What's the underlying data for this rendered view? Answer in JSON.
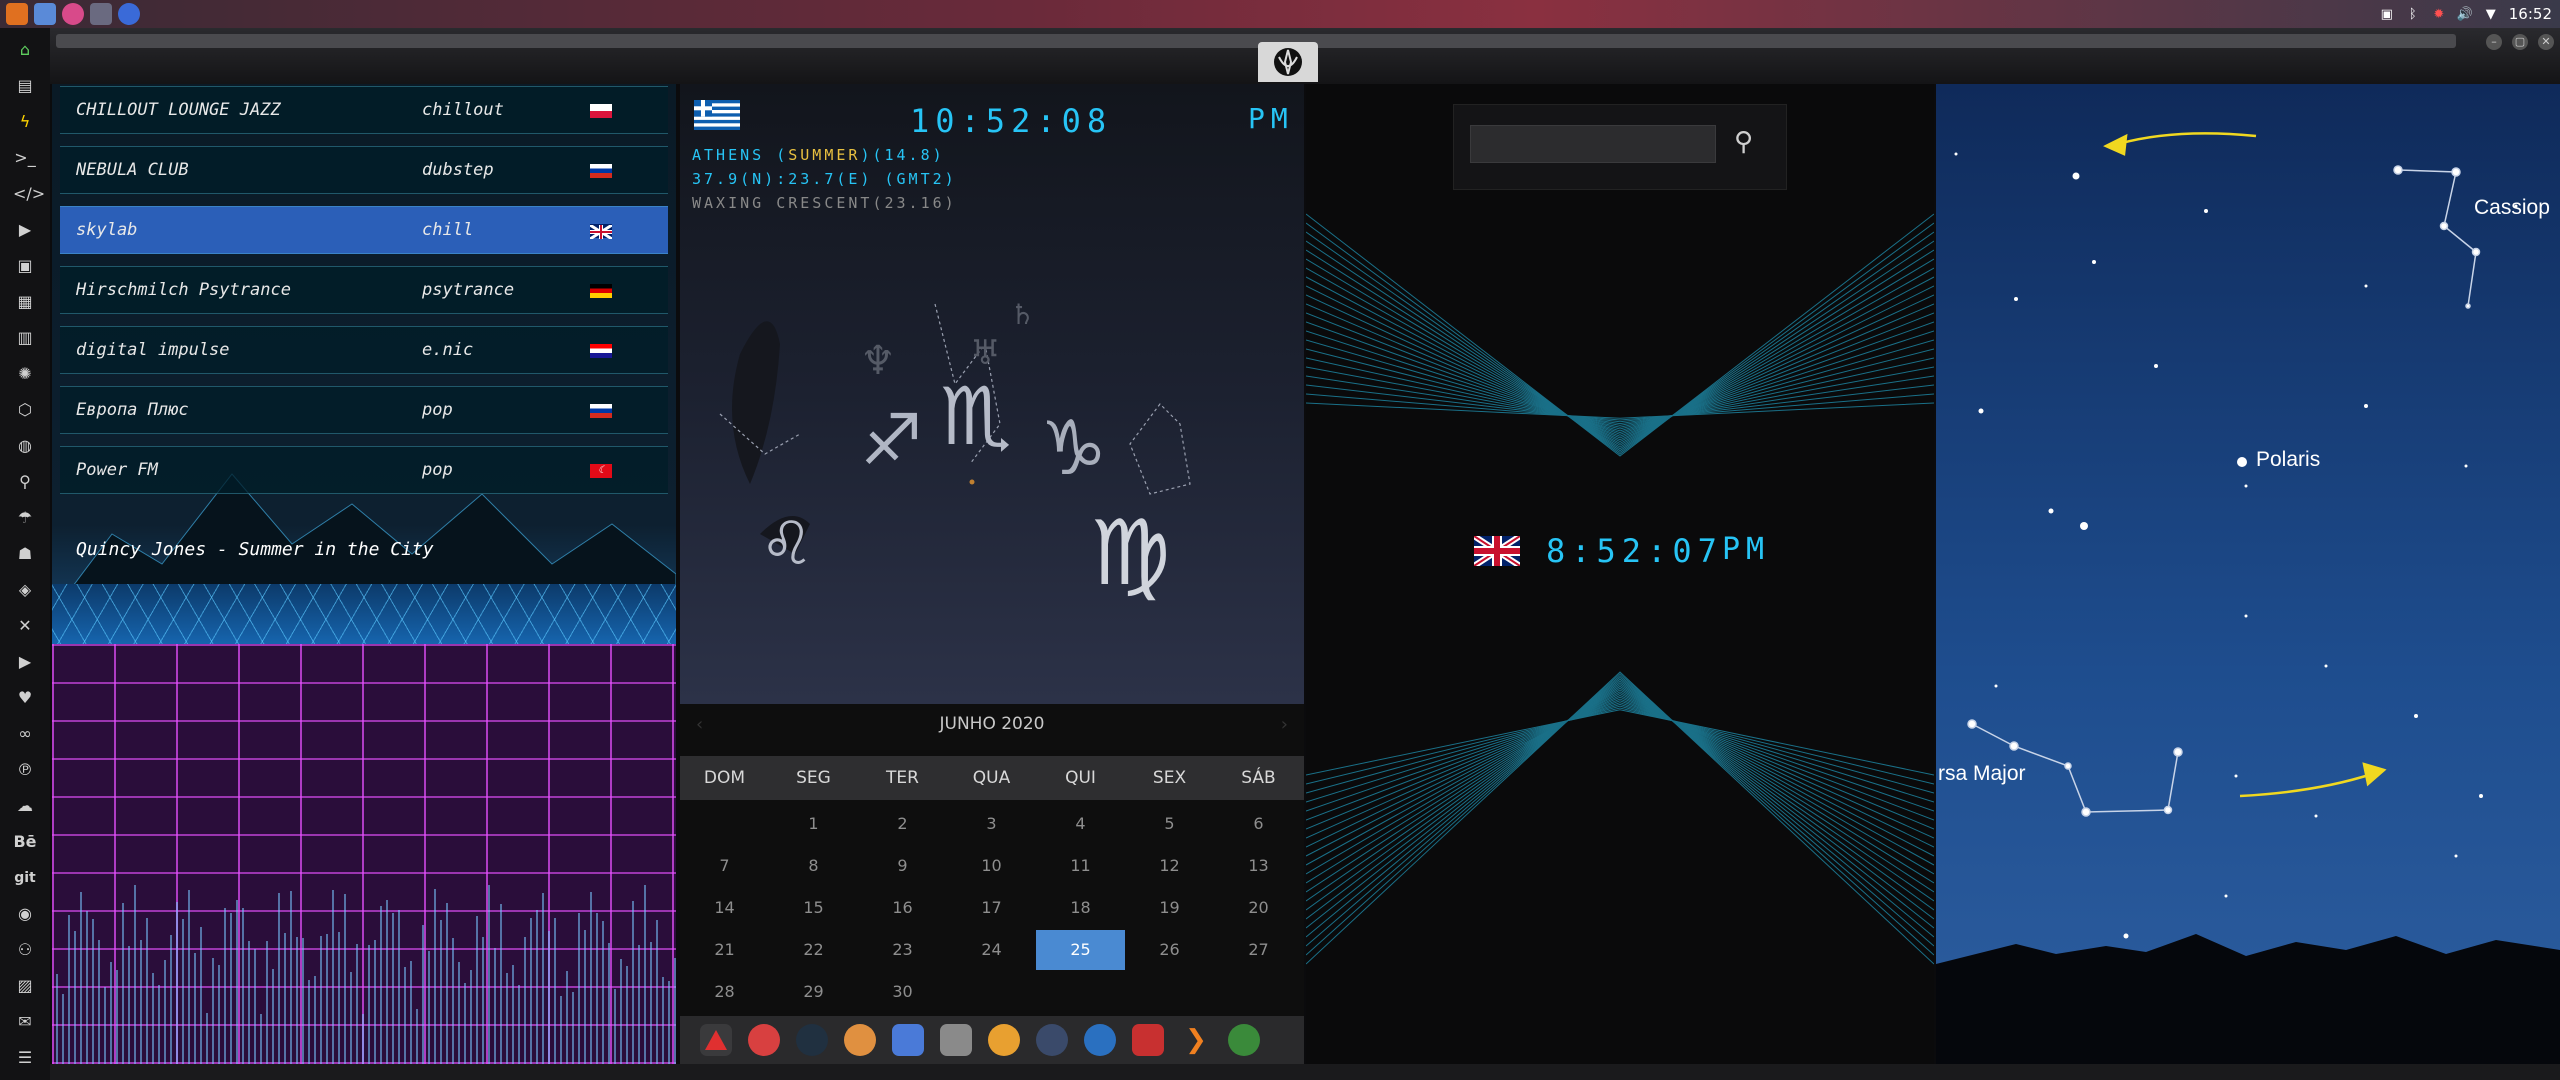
{
  "topbar": {
    "time": "16:52",
    "apps": [
      "files-app-icon",
      "browser-icon",
      "terminal-icon",
      "chrome-icon"
    ]
  },
  "radio": {
    "stations": [
      {
        "name": "CHILLOUT LOUNGE JAZZ",
        "genre": "chillout",
        "flag": "poland"
      },
      {
        "name": "NEBULA CLUB",
        "genre": "dubstep",
        "flag": "russia"
      },
      {
        "name": "skylab",
        "genre": "chill",
        "flag": "uk"
      },
      {
        "name": "Hirschmilch Psytrance",
        "genre": "psytrance",
        "flag": "germany"
      },
      {
        "name": "digital impulse",
        "genre": "e.nic",
        "flag": "croatia"
      },
      {
        "name": "Европа Плюс",
        "genre": "pop",
        "flag": "russia"
      },
      {
        "name": "Power FM",
        "genre": "pop",
        "flag": "turkey"
      }
    ],
    "selected_index": 2,
    "now_playing": "Quincy Jones - Summer in the City"
  },
  "athens_clock": {
    "time": "10:52:08",
    "ampm": "PM",
    "city": "ATHENS",
    "season": "SUMMER",
    "temp": "(14.8)",
    "coords": "37.9(N):23.7(E) (GMT2)",
    "moon": "WAXING CRESCENT(23.16)"
  },
  "calendar": {
    "month_title": "JUNHO 2020",
    "weekdays": [
      "DOM",
      "SEG",
      "TER",
      "QUA",
      "QUI",
      "SEX",
      "SÁB"
    ],
    "weeks": [
      [
        "",
        "1",
        "2",
        "3",
        "4",
        "5",
        "6"
      ],
      [
        "7",
        "8",
        "9",
        "10",
        "11",
        "12",
        "13"
      ],
      [
        "14",
        "15",
        "16",
        "17",
        "18",
        "19",
        "20"
      ],
      [
        "21",
        "22",
        "23",
        "24",
        "25",
        "26",
        "27"
      ],
      [
        "28",
        "29",
        "30",
        "",
        "",
        "",
        ""
      ]
    ],
    "today": "25",
    "prev_label": "‹",
    "next_label": "›"
  },
  "london_clock": {
    "time": "8:52:07",
    "ampm": "PM"
  },
  "search": {
    "placeholder": "",
    "value": ""
  },
  "star_map": {
    "labels": {
      "cassiopeia": "Cassiop",
      "polaris": "Polaris",
      "ursa_major": "rsa Major"
    }
  },
  "colors": {
    "accent_blue": "#2b5fb8",
    "lcd_cyan": "#27c4f5",
    "today_blue": "#4a8ad2"
  }
}
